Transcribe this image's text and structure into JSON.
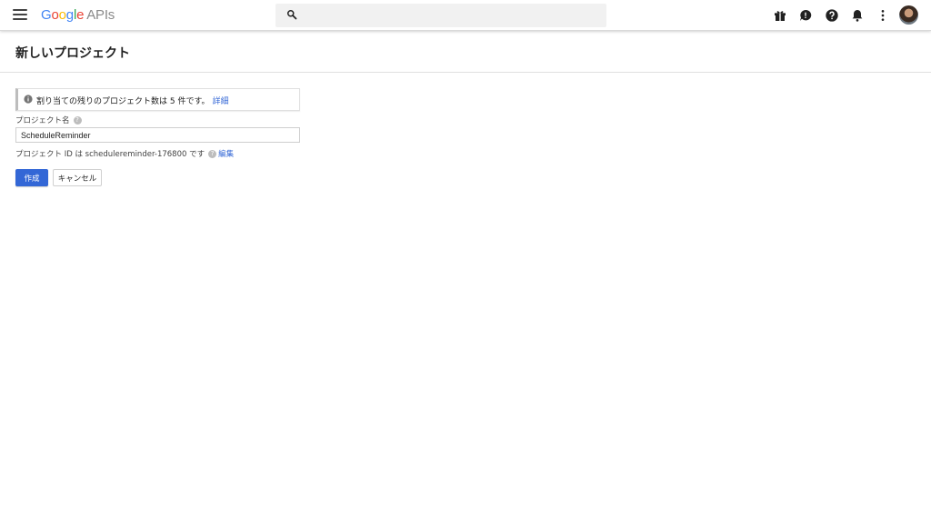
{
  "header": {
    "logo_letters": [
      "G",
      "o",
      "o",
      "g",
      "l",
      "e"
    ],
    "logo_suffix": "APIs",
    "search": {
      "value": "",
      "placeholder": ""
    },
    "icons": [
      "gift-icon",
      "feedback-icon",
      "help-icon",
      "notifications-icon",
      "more-vert-icon"
    ]
  },
  "page": {
    "title": "新しいプロジェクト"
  },
  "info_bar": {
    "text": "割り当ての残りのプロジェクト数は 5 件です。",
    "link": "詳細"
  },
  "form": {
    "name_label": "プロジェクト名",
    "help_glyph": "?",
    "name_value": "ScheduleReminder",
    "project_id_text": "プロジェクト ID は schedulereminder-176800 です",
    "edit_link": "編集"
  },
  "actions": {
    "create_label": "作成",
    "cancel_label": "キャンセル"
  },
  "colors": {
    "accent": "#3367d6",
    "google_blue": "#4285f4",
    "google_red": "#ea4335",
    "google_yellow": "#fbbc05",
    "google_green": "#34a853"
  }
}
